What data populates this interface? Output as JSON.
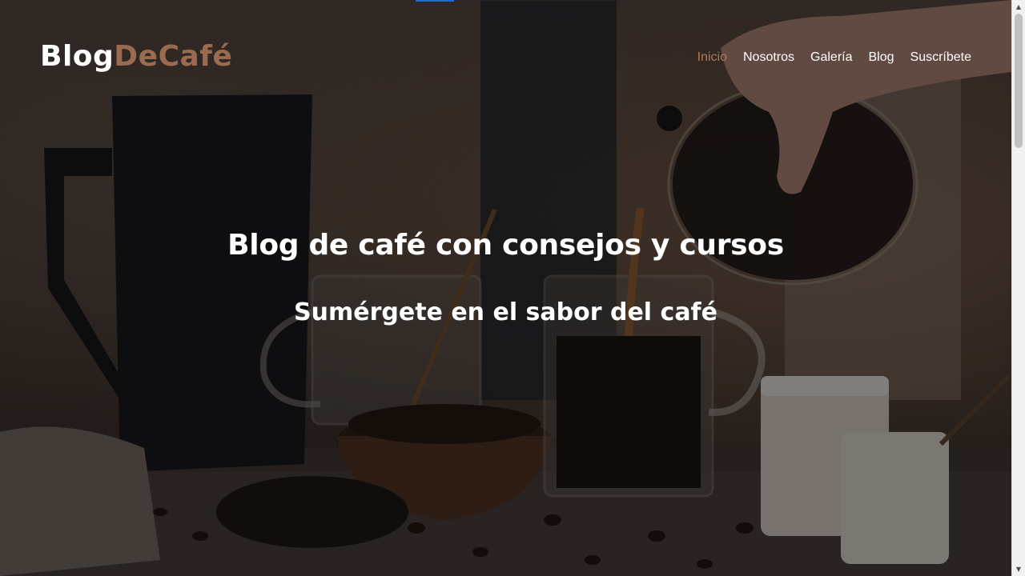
{
  "site": {
    "logo_part1": "Blog",
    "logo_part2": "DeCafé"
  },
  "nav": {
    "items": [
      {
        "label": "Inicio",
        "active": true
      },
      {
        "label": "Nosotros",
        "active": false
      },
      {
        "label": "Galería",
        "active": false
      },
      {
        "label": "Blog",
        "active": false
      },
      {
        "label": "Suscríbete",
        "active": false
      }
    ]
  },
  "hero": {
    "title": "Blog de café con consejos y cursos",
    "subtitle": "Sumérgete en el sabor del café"
  },
  "colors": {
    "accent": "#9a6b4f",
    "nav_active": "#b07a58",
    "text": "#ffffff",
    "loader": "#1e6bd6"
  },
  "icons": {
    "scroll_up": "triangle-up",
    "scroll_down": "triangle-down"
  }
}
